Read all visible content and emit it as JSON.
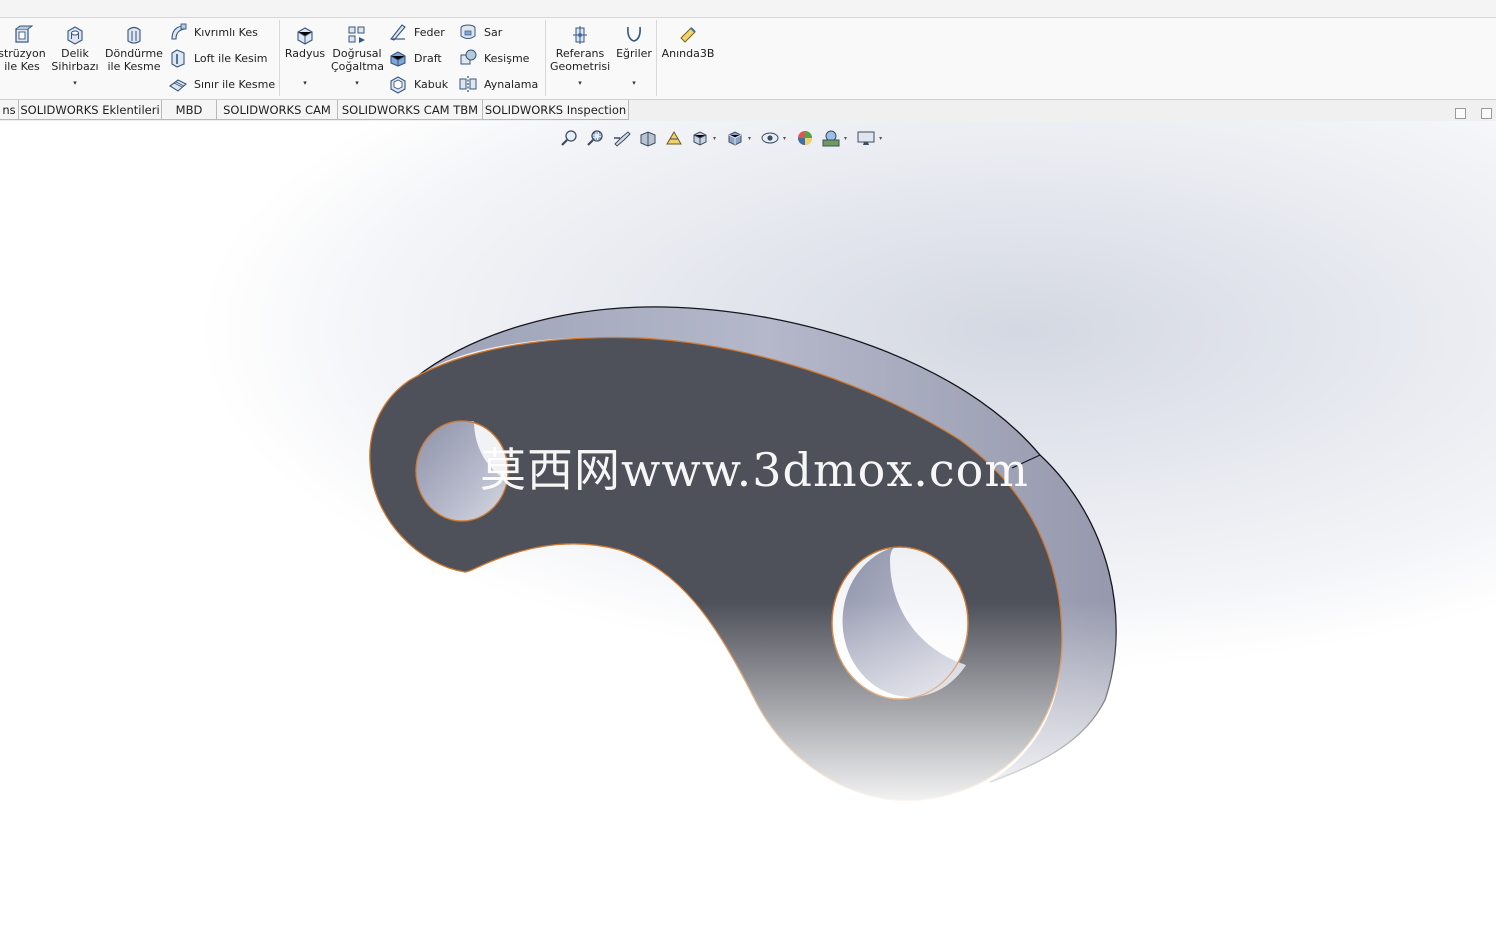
{
  "ribbon": {
    "extrude_cut_label": "strüzyon\nile Kes",
    "hole_wizard_label": "Delik\nSihirbazı",
    "revolve_cut_label": "Döndürme\nile Kesme",
    "swept_cut_label": "Kıvrımlı Kes",
    "lofted_cut_label": "Loft ile Kesim",
    "boundary_cut_label": "Sınır ile Kesme",
    "fillet_label": "Radyus",
    "linear_pattern_label": "Doğrusal\nÇoğaltma",
    "rib_label": "Feder",
    "draft_label": "Draft",
    "shell_label": "Kabuk",
    "wrap_label": "Sar",
    "intersect_label": "Kesişme",
    "mirror_label": "Aynalama",
    "ref_geometry_label": "Referans\nGeometrisi",
    "curves_label": "Eğriler",
    "instant3d_label": "Anında3B",
    "dropdown_glyph": "▾"
  },
  "tabs": [
    {
      "label": "ns"
    },
    {
      "label": "SOLIDWORKS Eklentileri"
    },
    {
      "label": "MBD"
    },
    {
      "label": "SOLIDWORKS CAM"
    },
    {
      "label": "SOLIDWORKS CAM TBM"
    },
    {
      "label": "SOLIDWORKS Inspection"
    }
  ],
  "hud": {
    "dropdown_glyph": "▾"
  },
  "watermark": "莫西网www.3dmox.com",
  "colors": {
    "face_dark": "#4f515a",
    "side_light": "#a9adc0",
    "edge_highlight": "#d2782d",
    "edge_dark": "#14161c",
    "ribbon_bg": "#f9f9f9",
    "icon_blue": "#3f6fa8"
  }
}
